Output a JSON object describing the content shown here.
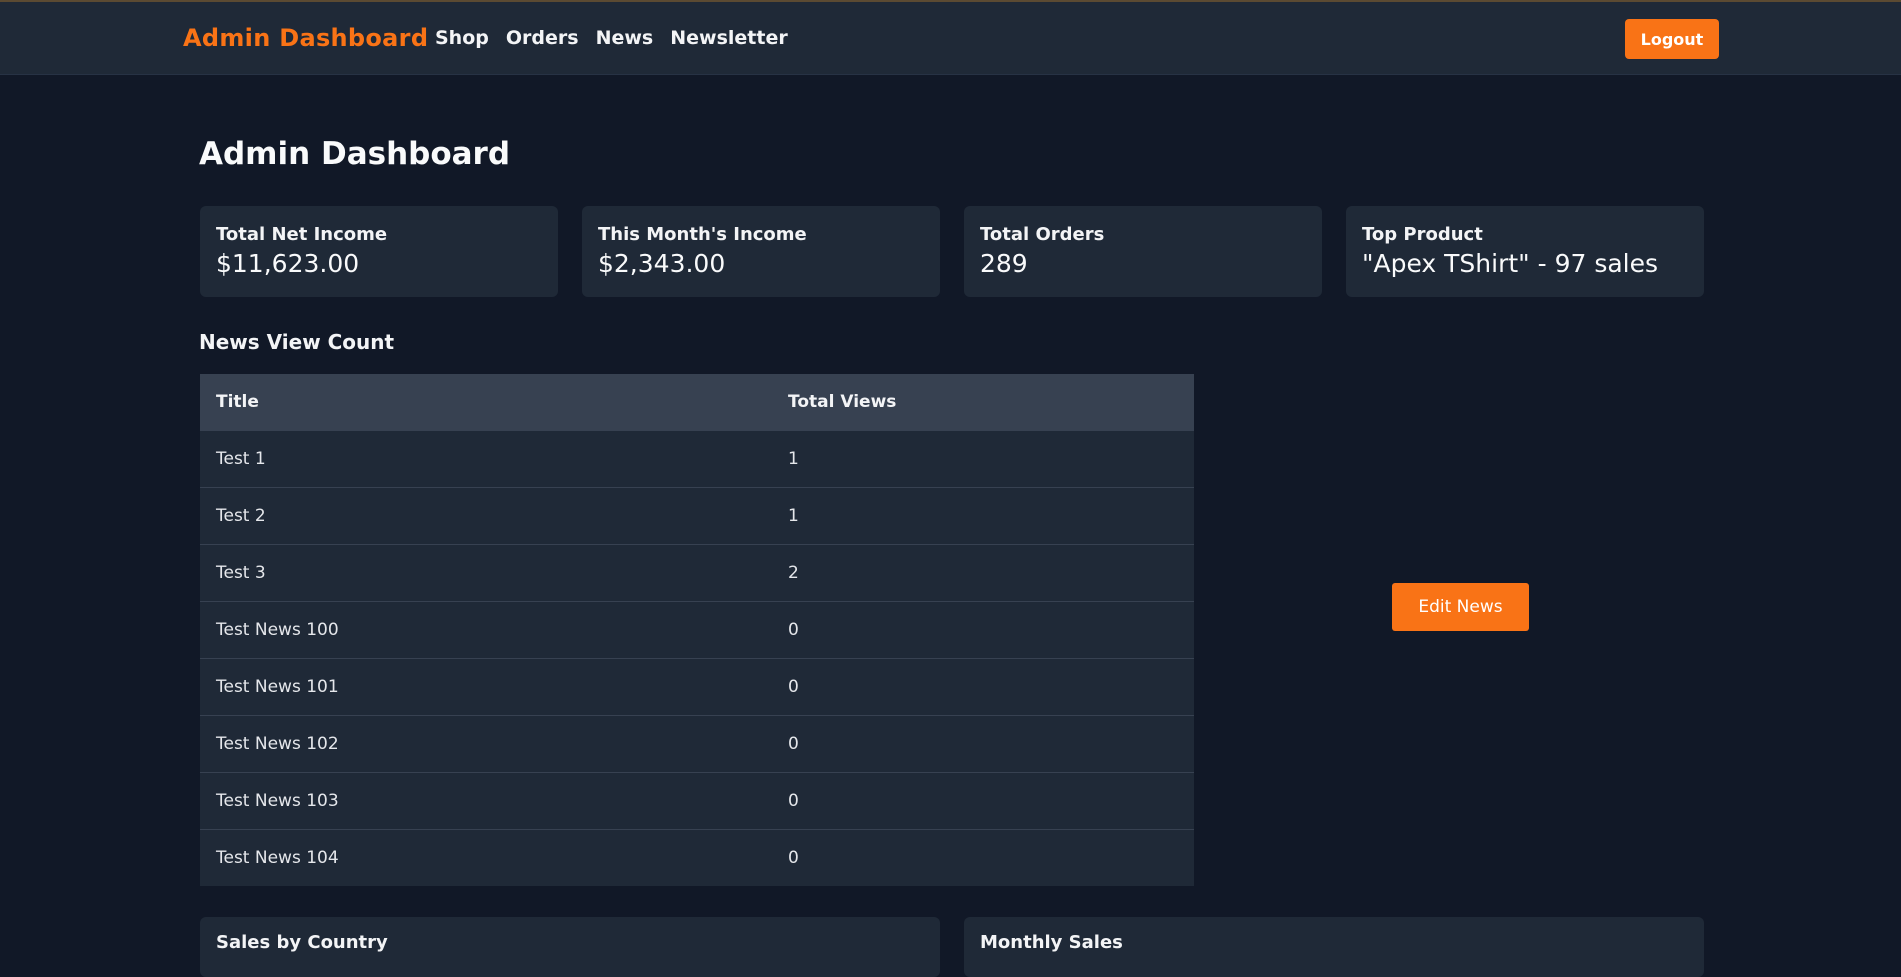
{
  "nav": {
    "brand": "Admin Dashboard",
    "links": [
      "Shop",
      "Orders",
      "News",
      "Newsletter"
    ],
    "logout_label": "Logout"
  },
  "page_title": "Admin Dashboard",
  "stats": [
    {
      "label": "Total Net Income",
      "value": "$11,623.00"
    },
    {
      "label": "This Month's Income",
      "value": "$2,343.00"
    },
    {
      "label": "Total Orders",
      "value": "289"
    },
    {
      "label": "Top Product",
      "value": "\"Apex TShirt\" - 97 sales"
    }
  ],
  "news_section": {
    "title": "News View Count",
    "columns": [
      "Title",
      "Total Views"
    ],
    "rows": [
      {
        "title": "Test 1",
        "views": "1"
      },
      {
        "title": "Test 2",
        "views": "1"
      },
      {
        "title": "Test 3",
        "views": "2"
      },
      {
        "title": "Test News 100",
        "views": "0"
      },
      {
        "title": "Test News 101",
        "views": "0"
      },
      {
        "title": "Test News 102",
        "views": "0"
      },
      {
        "title": "Test News 103",
        "views": "0"
      },
      {
        "title": "Test News 104",
        "views": "0"
      }
    ],
    "edit_label": "Edit News"
  },
  "bottom_cards": [
    "Sales by Country",
    "Monthly Sales"
  ],
  "colors": {
    "accent": "#f97316",
    "background": "#111827",
    "surface": "#1f2937",
    "header_row": "#374151"
  }
}
